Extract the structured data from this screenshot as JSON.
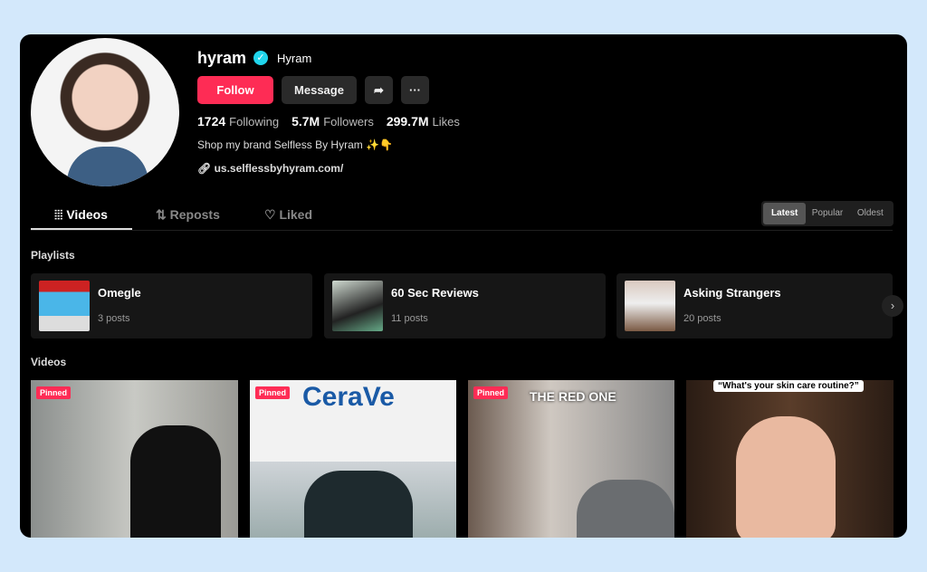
{
  "profile": {
    "username": "hyram",
    "nickname": "Hyram",
    "verified": true,
    "follow_label": "Follow",
    "message_label": "Message",
    "stats": [
      {
        "value": "1724",
        "label": "Following"
      },
      {
        "value": "5.7M",
        "label": "Followers"
      },
      {
        "value": "299.7M",
        "label": "Likes"
      }
    ],
    "bio": "Shop my brand Selfless By Hyram ✨👇",
    "link": "us.selflessbyhyram.com/"
  },
  "tabs": [
    {
      "label": "Videos",
      "icon": "grid-icon",
      "active": true
    },
    {
      "label": "Reposts",
      "icon": "repost-icon"
    },
    {
      "label": "Liked",
      "icon": "heart-icon"
    }
  ],
  "sort": {
    "options": [
      "Latest",
      "Popular",
      "Oldest"
    ],
    "selected": "Latest"
  },
  "playlists_title": "Playlists",
  "playlists": [
    {
      "title": "Omegle",
      "count": "3 posts"
    },
    {
      "title": "60 Sec Reviews",
      "count": "11 posts"
    },
    {
      "title": "Asking Strangers",
      "count": "20 posts"
    }
  ],
  "videos_title": "Videos",
  "videos": [
    {
      "badge": "Pinned",
      "overlay": ""
    },
    {
      "badge": "Pinned",
      "overlay": "CeraVe"
    },
    {
      "badge": "Pinned",
      "overlay": "THE RED ONE"
    },
    {
      "badge": "",
      "overlay": "“What's your skin care routine?”"
    }
  ],
  "colors": {
    "accent": "#fe2c55",
    "verified": "#20d5ec",
    "background": "#000000"
  }
}
